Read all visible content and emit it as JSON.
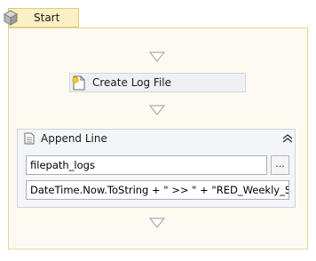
{
  "sequence": {
    "title": "Start"
  },
  "activities": {
    "create_log": {
      "label": "Create Log File"
    },
    "append_line": {
      "title": "Append Line",
      "file_field_value": "filepath_logs",
      "text_field_value": "DateTime.Now.ToString + \" >> \" + \"RED_Weekly_Statu",
      "ellipsis_label": "..."
    }
  },
  "icons": {
    "sequence": "sequence-icon",
    "create_log": "new-document-icon",
    "append_line": "document-icon",
    "collapse": "collapse-chevron-icon",
    "drop": "drop-target-arrow-icon"
  },
  "colors": {
    "sequence_header": "#fbf0c4",
    "sequence_body": "#fdfbf1",
    "sequence_border": "#e7d59c",
    "activity_bg": "#eef0f3"
  }
}
